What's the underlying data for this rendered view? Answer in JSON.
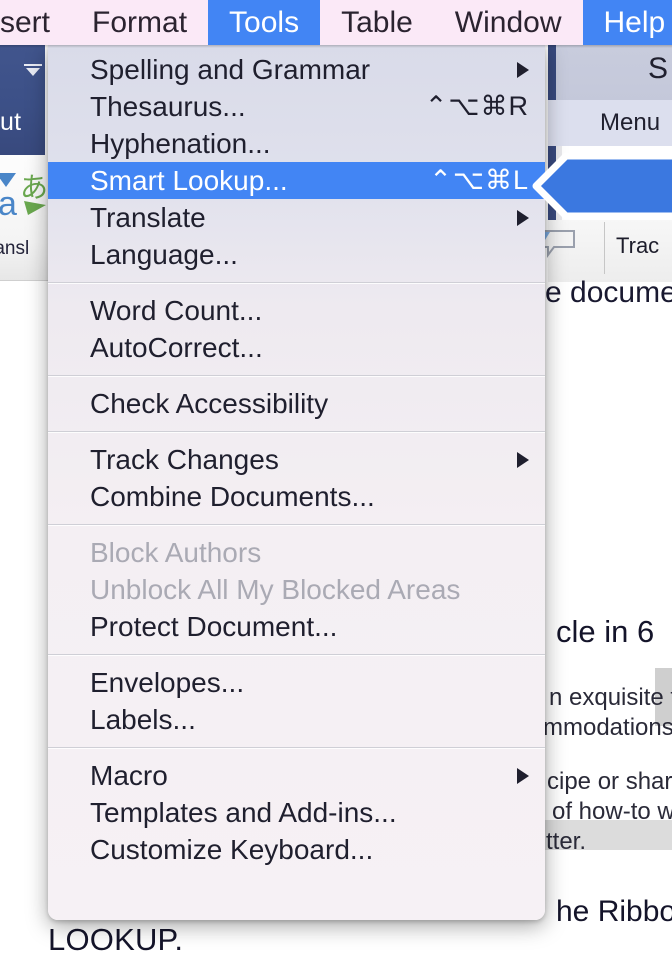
{
  "menubar": {
    "items": [
      {
        "label": "sert",
        "active": false,
        "name": "menubar-item-insert"
      },
      {
        "label": "Format",
        "active": false,
        "name": "menubar-item-format"
      },
      {
        "label": "Tools",
        "active": true,
        "name": "menubar-item-tools"
      },
      {
        "label": "Table",
        "active": false,
        "name": "menubar-item-table"
      },
      {
        "label": "Window",
        "active": false,
        "name": "menubar-item-window"
      },
      {
        "label": "Help",
        "active": true,
        "name": "menubar-item-help"
      }
    ],
    "active_color": "#4285f4",
    "background_color": "#fbe9f7"
  },
  "tools_menu": {
    "groups": [
      {
        "items": [
          {
            "label": "Spelling and Grammar",
            "shortcut": "",
            "submenu": true,
            "disabled": false,
            "selected": false
          },
          {
            "label": "Thesaurus...",
            "shortcut": "⌃⌥⌘R",
            "submenu": false,
            "disabled": false,
            "selected": false
          },
          {
            "label": "Hyphenation...",
            "shortcut": "",
            "submenu": false,
            "disabled": false,
            "selected": false
          },
          {
            "label": "Smart Lookup...",
            "shortcut": "⌃⌥⌘L",
            "submenu": false,
            "disabled": false,
            "selected": true
          },
          {
            "label": "Translate",
            "shortcut": "",
            "submenu": true,
            "disabled": false,
            "selected": false
          },
          {
            "label": "Language...",
            "shortcut": "",
            "submenu": false,
            "disabled": false,
            "selected": false
          }
        ]
      },
      {
        "items": [
          {
            "label": "Word Count...",
            "shortcut": "",
            "submenu": false,
            "disabled": false,
            "selected": false
          },
          {
            "label": "AutoCorrect...",
            "shortcut": "",
            "submenu": false,
            "disabled": false,
            "selected": false
          }
        ]
      },
      {
        "items": [
          {
            "label": "Check Accessibility",
            "shortcut": "",
            "submenu": false,
            "disabled": false,
            "selected": false
          }
        ]
      },
      {
        "items": [
          {
            "label": "Track Changes",
            "shortcut": "",
            "submenu": true,
            "disabled": false,
            "selected": false
          },
          {
            "label": "Combine Documents...",
            "shortcut": "",
            "submenu": false,
            "disabled": false,
            "selected": false
          }
        ]
      },
      {
        "items": [
          {
            "label": "Block Authors",
            "shortcut": "",
            "submenu": false,
            "disabled": true,
            "selected": false
          },
          {
            "label": "Unblock All My Blocked Areas",
            "shortcut": "",
            "submenu": false,
            "disabled": true,
            "selected": false
          },
          {
            "label": "Protect Document...",
            "shortcut": "",
            "submenu": false,
            "disabled": false,
            "selected": false
          }
        ]
      },
      {
        "items": [
          {
            "label": "Envelopes...",
            "shortcut": "",
            "submenu": false,
            "disabled": false,
            "selected": false
          },
          {
            "label": "Labels...",
            "shortcut": "",
            "submenu": false,
            "disabled": false,
            "selected": false
          }
        ]
      },
      {
        "items": [
          {
            "label": "Macro",
            "shortcut": "",
            "submenu": true,
            "disabled": false,
            "selected": false
          },
          {
            "label": "Templates and Add-ins...",
            "shortcut": "",
            "submenu": false,
            "disabled": false,
            "selected": false
          },
          {
            "label": "Customize Keyboard...",
            "shortcut": "",
            "submenu": false,
            "disabled": false,
            "selected": false
          }
        ]
      }
    ],
    "highlight_color": "#4285f4",
    "disabled_color": "#aaaab4"
  },
  "background": {
    "ribbon_tab_label": "ut",
    "translate_caption": "ransl",
    "right_panel_title": "S",
    "right_panel_sub_label": "Menu",
    "right_toolbar_label": "Trac",
    "doc_line_1": "e docume",
    "doc_heading": "cle in 6",
    "doc_line_b1": "n exquisite t",
    "doc_line_b2": "mmodations",
    "doc_line_b3": "cipe or share",
    "doc_line_b4": "of how-to w",
    "doc_line_b5": "tter.",
    "doc_line_ribbon": "he Ribbon",
    "bottom_text": "LOOKUP.",
    "callout_color": "#3b78e0",
    "ribbon_accent_color": "#3c5087"
  }
}
